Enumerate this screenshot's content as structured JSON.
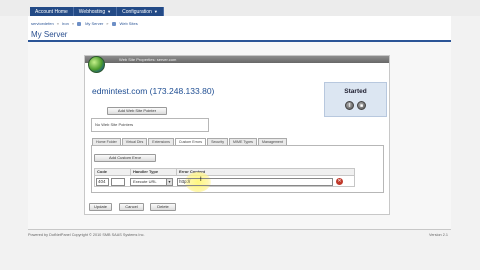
{
  "top_nav": {
    "tabs": [
      {
        "label": "Account Home"
      },
      {
        "label": "Webhosting",
        "has_menu": true
      },
      {
        "label": "Configuration",
        "has_menu": true
      }
    ]
  },
  "breadcrumb": {
    "items": [
      "servicedefen",
      "Iron",
      "My Server",
      "Web Sites"
    ]
  },
  "page_title": "My Server",
  "panel": {
    "title": "Web Site Properties: server.com",
    "host": "edmintest.com (173.248.133.80)",
    "status": "Started",
    "add_alias_button": "Add Web Site Pointer",
    "aliases_text": "No Web Site Pointers",
    "tabs": [
      "Home Folder",
      "Virtual Dirs",
      "Extensions",
      "Custom Errors",
      "Security",
      "MIME Types",
      "Management"
    ],
    "active_tab": "Custom Errors",
    "add_error_button": "Add Custom Error",
    "grid": {
      "headers": [
        "Code",
        "Handler Type",
        "Error Content"
      ],
      "rows": [
        {
          "code": "404",
          "handler": "Execute URL",
          "content": "http://"
        }
      ]
    },
    "buttons": {
      "update": "Update",
      "cancel": "Cancel",
      "delete": "Delete"
    }
  },
  "footer": {
    "left": "Powered by DotNetPanel  Copyright © 2010 SMB SAAS Systems Inc.",
    "right": "Version 2.1"
  },
  "colors": {
    "nav": "#234a86",
    "accent": "#2b5597",
    "highlight": "#fff478"
  }
}
